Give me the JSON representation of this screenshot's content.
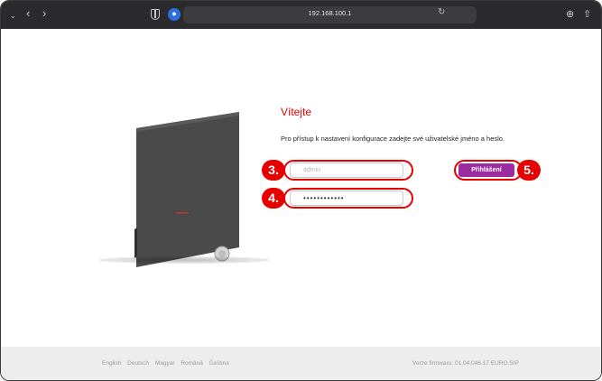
{
  "browser": {
    "url": "192.168.100.1",
    "icons": {
      "sidebar_toggle": "chevron-down-icon",
      "back": "back-arrow-icon",
      "forward": "forward-arrow-icon",
      "shield": "shield-icon",
      "password": "password-manager-icon",
      "reload": "reload-icon",
      "download": "download-icon",
      "share": "share-icon"
    }
  },
  "login": {
    "welcome": "Vítejte",
    "intro": "Pro přístup k nastavení konfigurace zadejte své uživatelské jméno a heslo.",
    "username_placeholder": "admin",
    "password_value": "••••••••••••",
    "submit_label": "Přihlášení"
  },
  "annotations": {
    "step_username": "3.",
    "step_password": "4.",
    "step_login": "5.",
    "color": "#e60000"
  },
  "footer": {
    "languages": [
      "English",
      "Deutsch",
      "Magyar",
      "Română",
      "Čeština"
    ],
    "firmware": "Verze firmwaru: 01.04.046.17.EURO.SIP"
  },
  "colors": {
    "accent": "#e60000",
    "button": "#9c2ba0",
    "toolbar": "#2b2b2d",
    "footer_bg": "#ededed"
  }
}
